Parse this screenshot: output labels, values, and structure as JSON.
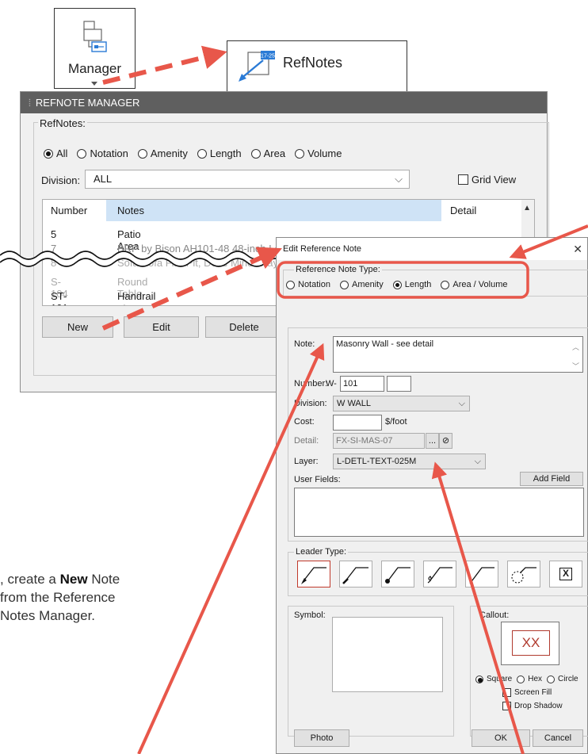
{
  "manager_button": {
    "label": "Manager"
  },
  "refnotes_button": {
    "label": "RefNotes",
    "icon_text": "17-25"
  },
  "manager_panel": {
    "title": "REFNOTE MANAGER",
    "group_label": "RefNotes:",
    "filters": [
      {
        "label": "All",
        "selected": true
      },
      {
        "label": "Notation",
        "selected": false
      },
      {
        "label": "Amenity",
        "selected": false
      },
      {
        "label": "Length",
        "selected": false
      },
      {
        "label": "Area",
        "selected": false
      },
      {
        "label": "Volume",
        "selected": false
      }
    ],
    "division_label": "Division:",
    "division_value": "ALL",
    "grid_view_label": "Grid View",
    "columns": [
      "Number",
      "Notes",
      "Detail"
    ],
    "rows": [
      {
        "number": "5",
        "note": "Patio Area",
        "detail": ""
      },
      {
        "number": "7",
        "note": "BRP by Bison AH101-48 48-inch Length Straight Backed B...",
        "detail": ""
      },
      {
        "number": "8",
        "note": "Sofa Sofa Fire Pit, Dove Mine Gray",
        "detail": ""
      },
      {
        "number": "S-104",
        "note": "Round Table",
        "detail": ""
      },
      {
        "number": "ST-101",
        "note": "Handrail at ramp",
        "detail": ""
      }
    ],
    "buttons": {
      "new": "New",
      "edit": "Edit",
      "delete": "Delete"
    }
  },
  "edit_dialog": {
    "title": "Edit Reference Note",
    "type_group_label": "Reference Note Type:",
    "types": [
      {
        "label": "Notation",
        "selected": false
      },
      {
        "label": "Amenity",
        "selected": false
      },
      {
        "label": "Length",
        "selected": true
      },
      {
        "label": "Area / Volume",
        "selected": false
      }
    ],
    "note_label": "Note:",
    "note_value": "Masonry Wall - see detail",
    "number_label": "Number:",
    "number_prefix": "W-",
    "number_value": "101",
    "number_suffix": "",
    "division_label": "Division:",
    "division_value": "W  WALL",
    "cost_label": "Cost:",
    "cost_value": "",
    "cost_unit": "$/foot",
    "detail_label": "Detail:",
    "detail_value": "FX-SI-MAS-07",
    "detail_browse": "...",
    "detail_clear": "⊘",
    "layer_label": "Layer:",
    "layer_value": "L-DETL-TEXT-025M",
    "user_fields_label": "User Fields:",
    "add_field_label": "Add Field",
    "leader_type_label": "Leader Type:",
    "leader_none_label": "X",
    "symbol_label": "Symbol:",
    "callout_label": "Callout:",
    "callout_preview_text": "XX",
    "callout_shapes": [
      {
        "label": "Square",
        "selected": true
      },
      {
        "label": "Hex",
        "selected": false
      },
      {
        "label": "Circle",
        "selected": false
      }
    ],
    "screen_fill_label": "Screen Fill",
    "drop_shadow_label": "Drop Shadow",
    "photo_label": "Photo",
    "ok_label": "OK",
    "cancel_label": "Cancel"
  },
  "instruction": {
    "prefix": ", create a ",
    "bold": "New",
    "suffix": "Note from the Reference Notes Manager."
  },
  "colors": {
    "accent": "#e8574a",
    "title_bar": "#5f5f5f",
    "header_highlight": "#cfe3f6"
  }
}
